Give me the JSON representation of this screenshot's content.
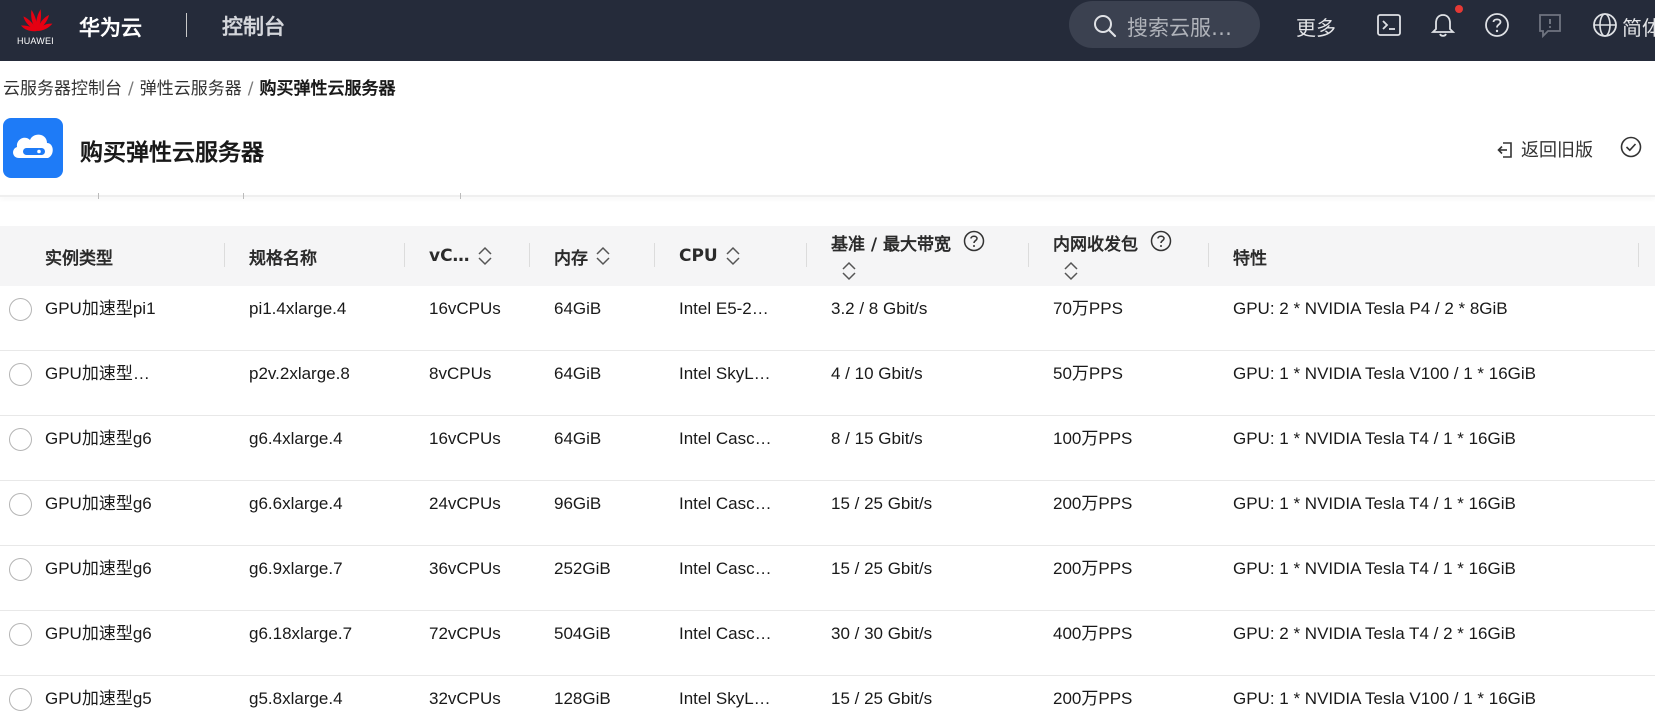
{
  "header": {
    "logo_text": "HUAWEI",
    "brand": "华为云",
    "console": "控制台",
    "search_placeholder": "搜索云服…",
    "more": "更多",
    "lang": "简体"
  },
  "breadcrumb": [
    "云服务器控制台",
    "弹性云服务器",
    "购买弹性云服务器"
  ],
  "page": {
    "title": "购买弹性云服务器",
    "back_old": "返回旧版"
  },
  "table": {
    "columns": [
      "实例类型",
      "规格名称",
      "vC…",
      "内存",
      "CPU",
      "基准 / 最大带宽",
      "内网收发包",
      "特性"
    ],
    "rows": [
      [
        "GPU加速型pi1",
        "pi1.4xlarge.4",
        "16vCPUs",
        "64GiB",
        "Intel E5-2…",
        "3.2 / 8 Gbit/s",
        "70万PPS",
        "GPU: 2 * NVIDIA Tesla P4 / 2 * 8GiB"
      ],
      [
        "GPU加速型…",
        "p2v.2xlarge.8",
        "8vCPUs",
        "64GiB",
        "Intel SkyL…",
        "4 / 10 Gbit/s",
        "50万PPS",
        "GPU: 1 * NVIDIA Tesla V100 / 1 * 16GiB"
      ],
      [
        "GPU加速型g6",
        "g6.4xlarge.4",
        "16vCPUs",
        "64GiB",
        "Intel Casc…",
        "8 / 15 Gbit/s",
        "100万PPS",
        "GPU: 1 * NVIDIA Tesla T4 / 1 * 16GiB"
      ],
      [
        "GPU加速型g6",
        "g6.6xlarge.4",
        "24vCPUs",
        "96GiB",
        "Intel Casc…",
        "15 / 25 Gbit/s",
        "200万PPS",
        "GPU: 1 * NVIDIA Tesla T4 / 1 * 16GiB"
      ],
      [
        "GPU加速型g6",
        "g6.9xlarge.7",
        "36vCPUs",
        "252GiB",
        "Intel Casc…",
        "15 / 25 Gbit/s",
        "200万PPS",
        "GPU: 1 * NVIDIA Tesla T4 / 1 * 16GiB"
      ],
      [
        "GPU加速型g6",
        "g6.18xlarge.7",
        "72vCPUs",
        "504GiB",
        "Intel Casc…",
        "30 / 30 Gbit/s",
        "400万PPS",
        "GPU: 2 * NVIDIA Tesla T4 / 2 * 16GiB"
      ],
      [
        "GPU加速型g5",
        "g5.8xlarge.4",
        "32vCPUs",
        "128GiB",
        "Intel SkyL…",
        "15 / 25 Gbit/s",
        "200万PPS",
        "GPU: 1 * NVIDIA Tesla V100 / 1 * 16GiB"
      ]
    ]
  },
  "colors": {
    "topbar": "#252b3a",
    "accent": "#1e7bf7",
    "notification": "#e53935"
  }
}
